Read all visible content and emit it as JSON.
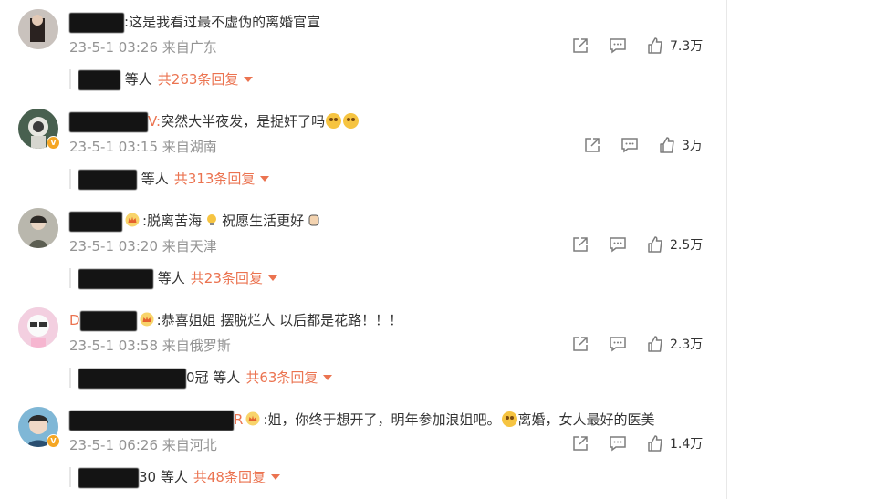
{
  "comments": [
    {
      "name_visible": "",
      "name_tail": ":",
      "text": "这是我看过最不虚伪的离婚官宣",
      "date": "23-5-1 03:26",
      "location": "来自广东",
      "likes": "7.3万",
      "reply_suffix": "等人",
      "reply_count": "共263条回复",
      "verified": false
    },
    {
      "name_visible": "",
      "name_tail": "V:",
      "text": "突然大半夜发，是捉奸了吗",
      "date": "23-5-1 03:15",
      "location": "来自湖南",
      "likes": "3万",
      "reply_suffix": "等人",
      "reply_count": "共313条回复",
      "verified": true
    },
    {
      "name_visible": "",
      "name_tail": ":",
      "text": "脱离苦海",
      "text2": "祝愿生活更好",
      "date": "23-5-1 03:20",
      "location": "来自天津",
      "likes": "2.5万",
      "reply_suffix": "等人",
      "reply_count": "共23条回复",
      "verified": false
    },
    {
      "name_visible": "D",
      "name_tail": ":",
      "text": "恭喜姐姐 摆脱烂人 以后都是花路！！！",
      "date": "23-5-1 03:58",
      "location": "来自俄罗斯",
      "likes": "2.3万",
      "reply_suffix": "0冠 等人",
      "reply_count": "共63条回复",
      "verified": false
    },
    {
      "name_visible": "",
      "name_tail": "R",
      "text": ":姐，你终于想开了，明年参加浪姐吧。",
      "text2": "离婚，女人最好的医美",
      "date": "23-5-1 06:26",
      "location": "来自河北",
      "likes": "1.4万",
      "reply_suffix": "30 等人",
      "reply_count": "共48条回复",
      "verified": true
    }
  ],
  "colors": {
    "accent": "#eb7350",
    "meta": "#939393",
    "text": "#333333"
  },
  "icons": [
    "share-icon",
    "comment-icon",
    "like-icon",
    "chevron-down-icon",
    "crown-badge-icon"
  ]
}
